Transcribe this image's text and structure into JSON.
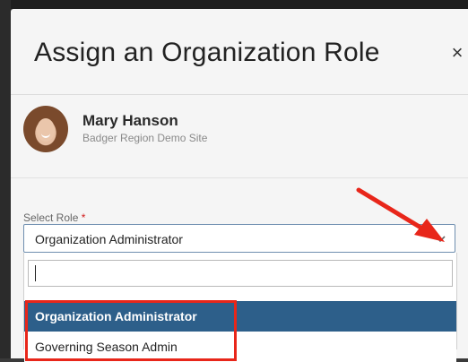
{
  "modal": {
    "title": "Assign an Organization Role",
    "close_glyph": "×"
  },
  "user": {
    "name": "Mary Hanson",
    "site": "Badger Region Demo Site"
  },
  "role_field": {
    "label": "Select Role",
    "required_marker": "*",
    "selected_value": "Organization Administrator",
    "search_value": ""
  },
  "options": [
    {
      "label": "Organization Administrator",
      "selected": true
    },
    {
      "label": "Governing Season Admin",
      "selected": false
    }
  ],
  "annotation": {
    "arrow_color": "#e8261a",
    "highlight_color": "#e8261a"
  },
  "colors": {
    "selected_option_bg": "#2d5f8a",
    "required": "#d11c1c"
  },
  "icons": {
    "close": "close-icon",
    "dropdown": "chevron-down-icon",
    "avatar": "user-avatar"
  }
}
